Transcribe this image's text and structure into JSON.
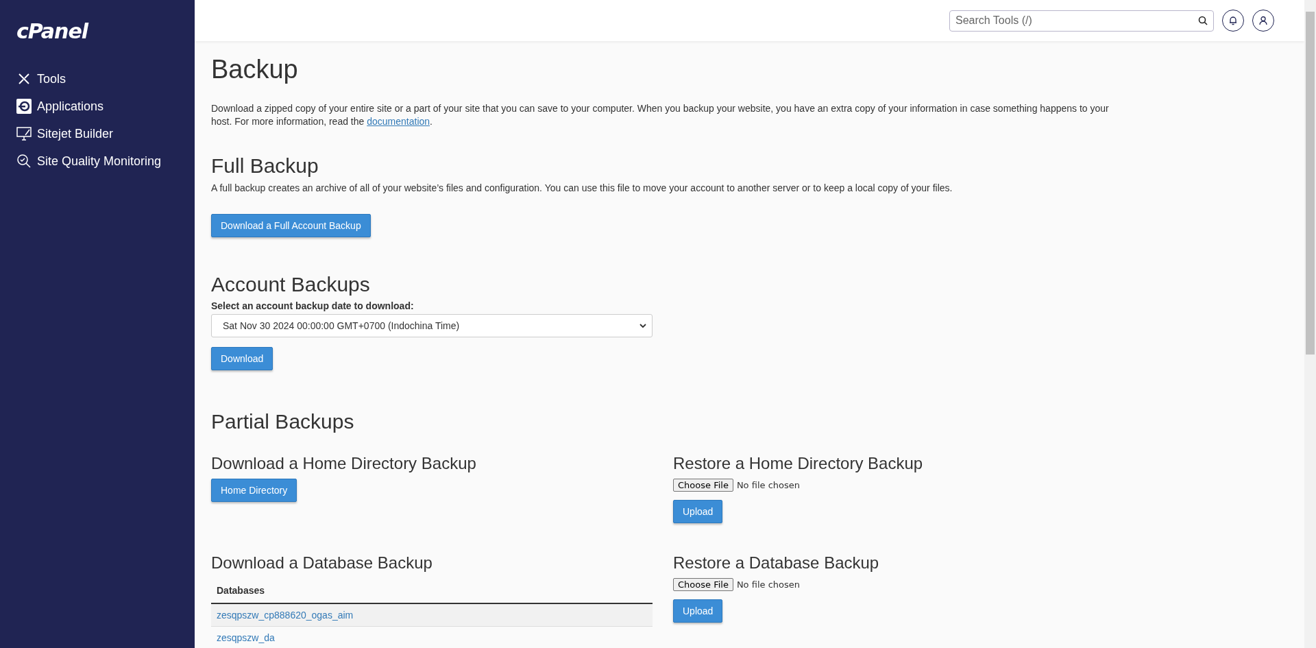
{
  "sidebar": {
    "logo": "cPanel",
    "items": [
      {
        "kind": "tools",
        "label": "Tools"
      },
      {
        "kind": "applications",
        "label": "Applications"
      },
      {
        "kind": "sitejet",
        "label": "Sitejet Builder"
      },
      {
        "kind": "monitoring",
        "label": "Site Quality Monitoring"
      }
    ]
  },
  "header": {
    "search": {
      "placeholder": "Search Tools (/)"
    }
  },
  "page": {
    "title": "Backup",
    "intro": "Download a zipped copy of your entire site or a part of your site that you can save to your computer. When you backup your website, you have an extra copy of your information in case something happens to your host. For more information, read the",
    "intro_link": "documentation",
    "intro_end": "."
  },
  "full_backup": {
    "heading": "Full Backup",
    "text": "A full backup creates an archive of all of your website’s files and configuration. You can use this file to move your account to another server or to keep a local copy of your files.",
    "button": "Download a Full Account Backup"
  },
  "account_backups": {
    "heading": "Account Backups",
    "label": "Select an account backup date to download:",
    "value": "Sat Nov 30 2024 00:00:00 GMT+0700 (Indochina Time)",
    "button": "Download"
  },
  "partial_backups": {
    "heading": "Partial Backups",
    "home_download": {
      "heading": "Download a Home Directory Backup",
      "button": "Home Directory"
    },
    "home_restore": {
      "heading": "Restore a Home Directory Backup",
      "choose": "Choose File",
      "status": "No file chosen",
      "button": "Upload"
    },
    "db_download": {
      "heading": "Download a Database Backup",
      "column": "Databases",
      "rows": [
        "zesqpszw_cp888620_ogas_aim",
        "zesqpszw_da"
      ]
    },
    "db_restore": {
      "heading": "Restore a Database Backup",
      "choose": "Choose File",
      "status": "No file chosen",
      "button": "Upload"
    }
  }
}
